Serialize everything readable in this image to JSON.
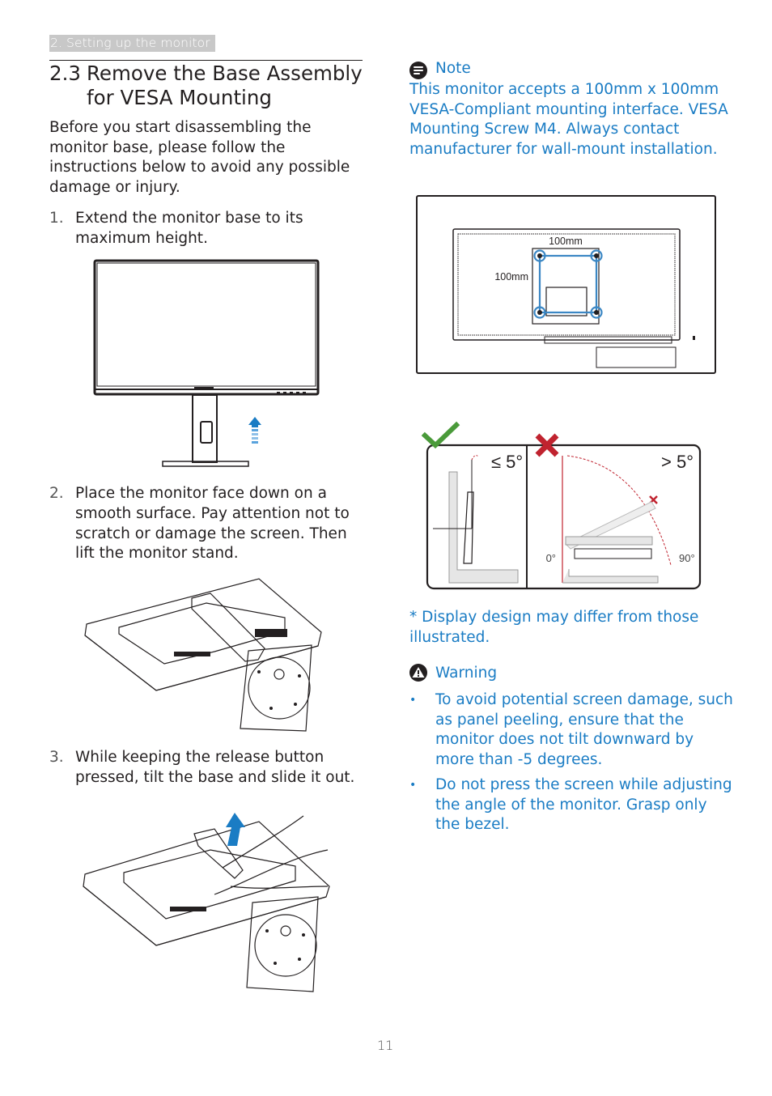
{
  "header": {
    "section_label": "2. Setting up the monitor"
  },
  "heading": {
    "number": "2.3",
    "title": "Remove the Base Assembly for VESA Mounting"
  },
  "intro": "Before you start disassembling the monitor base, please follow the instructions below to avoid any possible damage or injury.",
  "steps": [
    {
      "number": "1.",
      "text": "Extend the monitor base to its maximum height.",
      "figure": "monitor-front-raised-illustration"
    },
    {
      "number": "2.",
      "text": "Place the monitor face down on a smooth surface. Pay attention not to scratch or damage the screen. Then lift the monitor stand.",
      "figure": "monitor-face-down-stand-illustration"
    },
    {
      "number": "3.",
      "text": "While keeping the release button pressed, tilt the base and slide it out.",
      "figure": "release-button-slide-out-illustration"
    }
  ],
  "note": {
    "icon": "note-icon",
    "title": "Note",
    "text": "This monitor accepts a 100mm x 100mm VESA-Compliant mounting interface. VESA Mounting Screw M4. Always contact manufacturer for wall-mount installation."
  },
  "vesa_figure": {
    "width_label": "100mm",
    "height_label": "100mm",
    "accent_color": "#3b87c4"
  },
  "tilt_figure": {
    "ok_label": "≤ 5°",
    "bad_label": "> 5°",
    "angle_start": "0°",
    "angle_end": "90°",
    "ok_color": "#4a9a3a",
    "bad_color": "#c0232f"
  },
  "disclaimer": "* Display design may differ from those illustrated.",
  "warning": {
    "icon": "warning-icon",
    "title": "Warning",
    "bullets": [
      "To avoid potential screen damage, such as panel peeling, ensure that the monitor does not tilt downward by more than -5 degrees.",
      "Do not press the screen while adjusting the angle of the monitor. Grasp only the bezel."
    ]
  },
  "colors": {
    "text": "#231f20",
    "accent_blue": "#1a7cc4",
    "section_tab_bg": "#c8c8c8"
  },
  "page_number": "11"
}
